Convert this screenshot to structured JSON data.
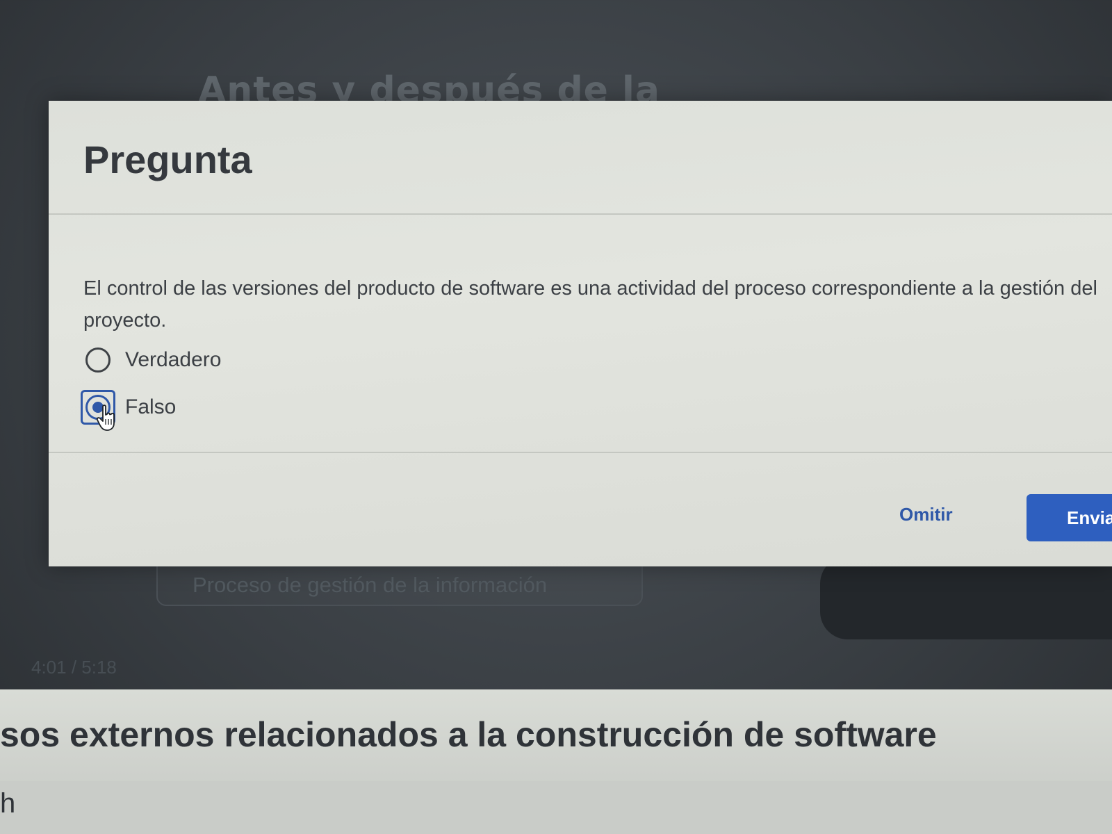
{
  "background": {
    "heading": "Antes y después de la",
    "process_button_label": "Proceso de gestión de la información",
    "timestamp": "4:01 / 5:18"
  },
  "modal": {
    "title": "Pregunta",
    "question": "El control de las versiones del producto de software es una actividad del proceso correspondiente a la gestión del proyecto.",
    "options": [
      {
        "label": "Verdadero",
        "selected": false
      },
      {
        "label": "Falso",
        "selected": true
      }
    ],
    "skip_label": "Omitir",
    "submit_label": "Enviar"
  },
  "page": {
    "section_title": "sos externos relacionados a la construcción de software",
    "cut_text": "h"
  },
  "colors": {
    "accent": "#2e5fbf",
    "modal_bg": "#e1e3dd",
    "text": "#3c4045"
  },
  "icons": {
    "cursor": "hand-pointer-icon"
  }
}
